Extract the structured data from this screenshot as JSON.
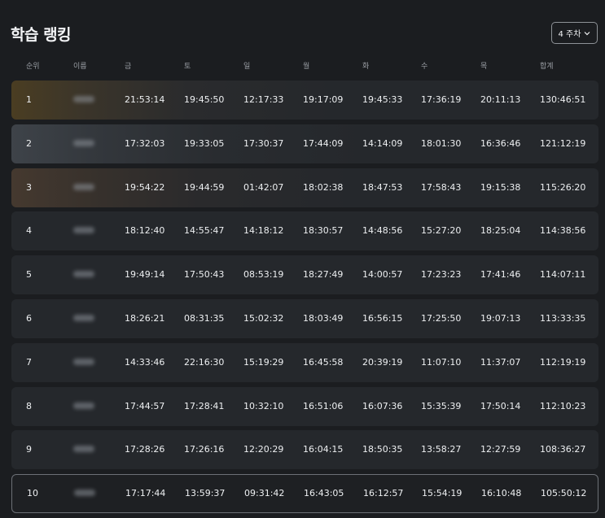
{
  "title": "학습 랭킹",
  "week_selector": {
    "label": "4 주차"
  },
  "columns": {
    "rank": "순위",
    "name": "이름",
    "fri": "금",
    "sat": "토",
    "sun": "일",
    "mon": "월",
    "tue": "화",
    "wed": "수",
    "thu": "목",
    "total": "합계"
  },
  "rows": [
    {
      "rank": "1",
      "fri": "21:53:14",
      "sat": "19:45:50",
      "sun": "12:17:33",
      "mon": "19:17:09",
      "tue": "19:45:33",
      "wed": "17:36:19",
      "thu": "20:11:13",
      "total": "130:46:51"
    },
    {
      "rank": "2",
      "fri": "17:32:03",
      "sat": "19:33:05",
      "sun": "17:30:37",
      "mon": "17:44:09",
      "tue": "14:14:09",
      "wed": "18:01:30",
      "thu": "16:36:46",
      "total": "121:12:19"
    },
    {
      "rank": "3",
      "fri": "19:54:22",
      "sat": "19:44:59",
      "sun": "01:42:07",
      "mon": "18:02:38",
      "tue": "18:47:53",
      "wed": "17:58:43",
      "thu": "19:15:38",
      "total": "115:26:20"
    },
    {
      "rank": "4",
      "fri": "18:12:40",
      "sat": "14:55:47",
      "sun": "14:18:12",
      "mon": "18:30:57",
      "tue": "14:48:56",
      "wed": "15:27:20",
      "thu": "18:25:04",
      "total": "114:38:56"
    },
    {
      "rank": "5",
      "fri": "19:49:14",
      "sat": "17:50:43",
      "sun": "08:53:19",
      "mon": "18:27:49",
      "tue": "14:00:57",
      "wed": "17:23:23",
      "thu": "17:41:46",
      "total": "114:07:11"
    },
    {
      "rank": "6",
      "fri": "18:26:21",
      "sat": "08:31:35",
      "sun": "15:02:32",
      "mon": "18:03:49",
      "tue": "16:56:15",
      "wed": "17:25:50",
      "thu": "19:07:13",
      "total": "113:33:35"
    },
    {
      "rank": "7",
      "fri": "14:33:46",
      "sat": "22:16:30",
      "sun": "15:19:29",
      "mon": "16:45:58",
      "tue": "20:39:19",
      "wed": "11:07:10",
      "thu": "11:37:07",
      "total": "112:19:19"
    },
    {
      "rank": "8",
      "fri": "17:44:57",
      "sat": "17:28:41",
      "sun": "10:32:10",
      "mon": "16:51:06",
      "tue": "16:07:36",
      "wed": "15:35:39",
      "thu": "17:50:14",
      "total": "112:10:23"
    },
    {
      "rank": "9",
      "fri": "17:28:26",
      "sat": "17:26:16",
      "sun": "12:20:29",
      "mon": "16:04:15",
      "tue": "18:50:35",
      "wed": "13:58:27",
      "thu": "12:27:59",
      "total": "108:36:27"
    },
    {
      "rank": "10",
      "fri": "17:17:44",
      "sat": "13:59:37",
      "sun": "09:31:42",
      "mon": "16:43:05",
      "tue": "16:12:57",
      "wed": "15:54:19",
      "thu": "16:10:48",
      "total": "105:50:12"
    }
  ],
  "highlighted_row_rank": "10",
  "colors": {
    "background": "#1b1d20",
    "row": "#25282c",
    "rank_1_tint": "#4a3d22",
    "rank_2_tint": "#3e4349",
    "rank_3_tint": "#45392f",
    "highlight_border": "#6c7076"
  }
}
